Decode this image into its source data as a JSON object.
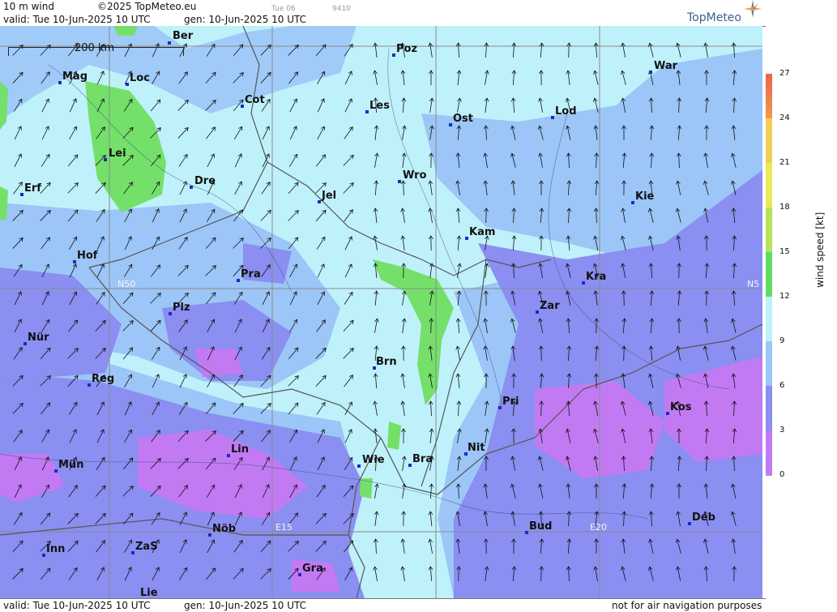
{
  "header": {
    "product": "10 m wind",
    "copyright": "©2025 TopMeteo.eu",
    "run_label": "Tue 06",
    "run_code": "9410",
    "valid": "valid:  Tue  10-Jun-2025  10 UTC",
    "gen": "gen: 10-Jun-2025 10 UTC",
    "brand": "TopMeteo"
  },
  "footer": {
    "valid": "valid:  Tue  10-Jun-2025  10 UTC",
    "gen": "gen: 10-Jun-2025 10 UTC",
    "disclaimer": "not for air navigation purposes"
  },
  "scale_bar": "200 km",
  "grid_labels": {
    "n50": "N50",
    "n50_right": "N5",
    "e15": "E15",
    "e20": "E20"
  },
  "legend": {
    "title": "wind speed [kt]",
    "ticks": [
      "27",
      "24",
      "21",
      "18",
      "15",
      "12",
      "9",
      "6",
      "3",
      "0"
    ],
    "colors": [
      "#ef6347",
      "#f19a4c",
      "#f4cf58",
      "#eaea59",
      "#b6e35a",
      "#5fdc63",
      "#bff1fb",
      "#9cc6f7",
      "#8a8ff1",
      "#c27af3"
    ]
  },
  "cities": {
    "ber": "Ber",
    "poz": "Poz",
    "war": "War",
    "mag": "Mag",
    "loc": "Loc",
    "cot": "Cot",
    "les": "Les",
    "ost": "Ost",
    "lod": "Lod",
    "lei": "Lei",
    "erf": "Erf",
    "dre": "Dre",
    "wro": "Wro",
    "jel": "Jel",
    "kie": "Kie",
    "kam": "Kam",
    "hof": "Hof",
    "pra": "Pra",
    "kra": "Kra",
    "zar": "Zar",
    "plz": "Plz",
    "nur": "Nür",
    "brn": "Brn",
    "reg": "Reg",
    "pri": "Pri",
    "kos": "Kos",
    "lin": "Lin",
    "nit": "Nit",
    "mun": "Mün",
    "wie": "Wie",
    "bra": "Bra",
    "nob": "Nöb",
    "bud": "Bud",
    "deb": "Deb",
    "inn": "Inn",
    "zas": "ZaS",
    "gra": "Gra",
    "lie": "Lie"
  }
}
